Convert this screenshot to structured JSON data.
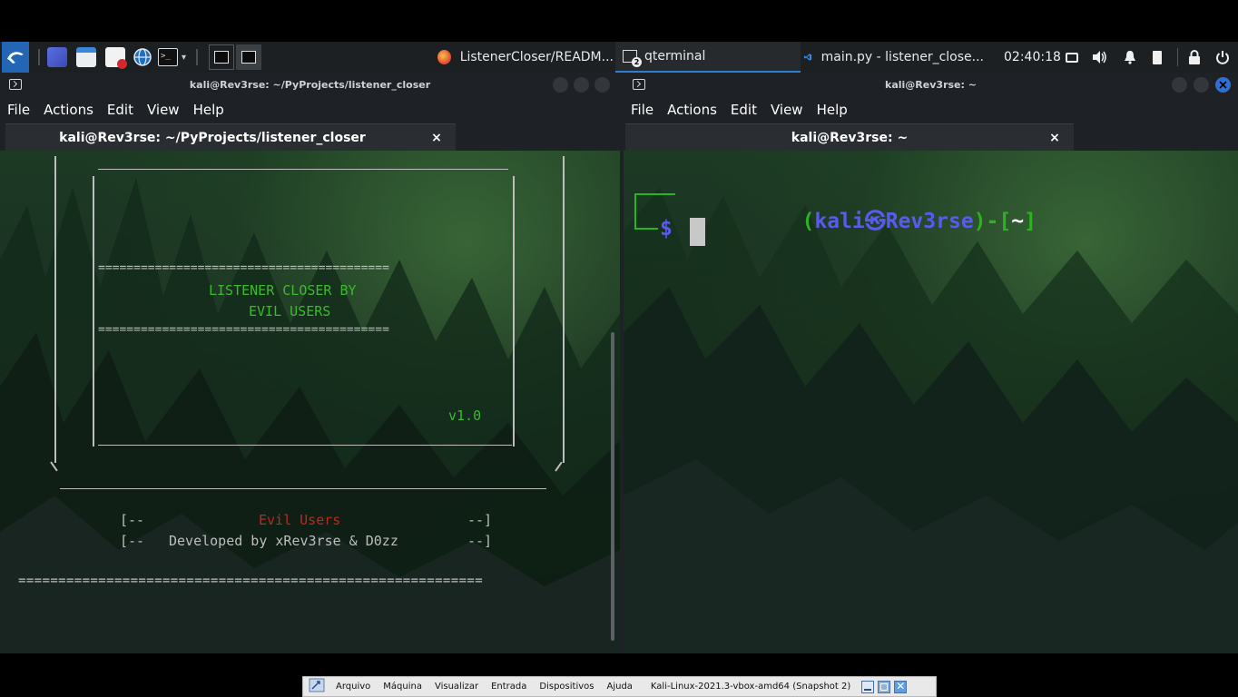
{
  "taskbar": {
    "tasks": [
      {
        "label": "ListenerCloser/READM..."
      },
      {
        "label": "qterminal",
        "badge": "2"
      },
      {
        "label": "main.py - listener_close..."
      }
    ],
    "clock": "02:40:18"
  },
  "left_window": {
    "title": "kali@Rev3rse: ~/PyProjects/listener_closer",
    "menu": [
      "File",
      "Actions",
      "Edit",
      "View",
      "Help"
    ],
    "tab_label": "kali@Rev3rse: ~/PyProjects/listener_closer",
    "tab_close": "×",
    "banner": {
      "rule": "=========================================",
      "title_line1": "LISTENER CLOSER BY",
      "title_line2": "EVIL USERS",
      "version": "v1.0",
      "credit1_open": "[--",
      "credit1_text": "Evil Users",
      "credit1_close": "--]",
      "credit2_open": "[--",
      "credit2_text": "Developed by xRev3rse & D0zz",
      "credit2_close": "--]",
      "long_rule": "=========================================================="
    },
    "colors": {
      "green": "#3cba2e",
      "red": "#c0281c",
      "grey": "#bdbdbd"
    }
  },
  "right_window": {
    "title": "kali@Rev3rse: ~",
    "menu": [
      "File",
      "Actions",
      "Edit",
      "View",
      "Help"
    ],
    "tab_label": "kali@Rev3rse: ~",
    "tab_close": "×",
    "prompt": {
      "open": "(",
      "user": "kali",
      "sep": "㉿",
      "host": "Rev3rse",
      "mid": ")-[",
      "dir": "~",
      "close": "]",
      "dollar": "$"
    },
    "colors": {
      "green": "#2ab51f",
      "blue": "#5a5af0"
    }
  },
  "vbox_bar": {
    "menu": [
      "Arquivo",
      "Máquina",
      "Visualizar",
      "Entrada",
      "Dispositivos",
      "Ajuda"
    ],
    "vm_title": "Kali-Linux-2021.3-vbox-amd64 (Snapshot 2)"
  }
}
